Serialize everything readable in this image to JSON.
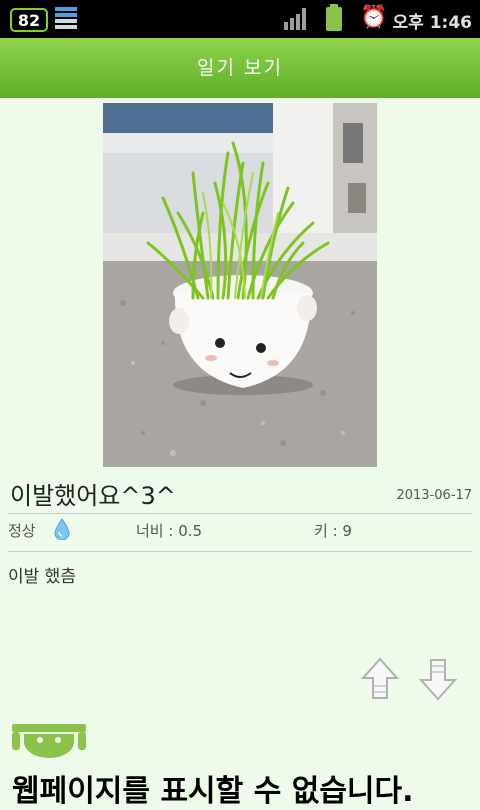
{
  "status_bar": {
    "notification_number": "82",
    "time": "오후 1:46",
    "icons": [
      "battery-number-icon",
      "storage-icon",
      "signal-icon",
      "battery-icon",
      "alarm-icon"
    ]
  },
  "header": {
    "title": "일기 보기"
  },
  "entry": {
    "title": "이발했어요^3^",
    "date": "2013-06-17",
    "status_label": "정상",
    "status_icon": "water-drop-icon",
    "width_label": "너비 : 0.5",
    "height_label": "키 : 9",
    "body": "이발 했츰"
  },
  "nav": {
    "up_icon": "arrow-up-icon",
    "down_icon": "arrow-down-icon"
  },
  "web_error": "웹페이지를 표시할 수 없습니다.",
  "colors": {
    "header_start": "#8fd44e",
    "header_end": "#5fae28",
    "background": "#eefbea",
    "android_green": "#8bc34a"
  }
}
